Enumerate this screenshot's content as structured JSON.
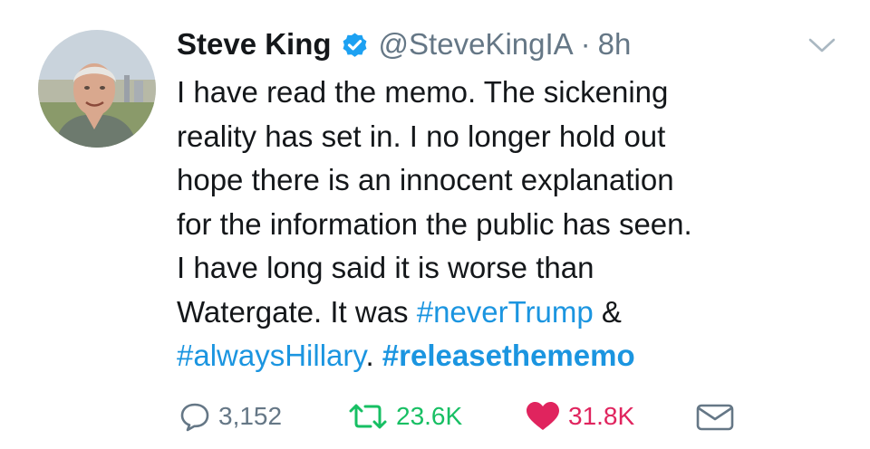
{
  "tweet": {
    "author": {
      "name": "Steve King",
      "handle": "@SteveKingIA",
      "separator": "·",
      "time": "8h",
      "avatar_icon": "profile-photo",
      "verified_icon": "verified-badge-icon"
    },
    "text_lines": [
      [
        {
          "text": "I have read the memo. The sickening",
          "kind": "plain"
        }
      ],
      [
        {
          "text": "reality has set in. I no longer hold out",
          "kind": "plain"
        }
      ],
      [
        {
          "text": "hope there is an innocent explanation",
          "kind": "plain"
        }
      ],
      [
        {
          "text": "for the information the public has seen.",
          "kind": "plain"
        }
      ],
      [
        {
          "text": "I have long said it is worse than",
          "kind": "plain"
        }
      ],
      [
        {
          "text": "Watergate. It was ",
          "kind": "plain"
        },
        {
          "text": "#neverTrump",
          "kind": "hashtag"
        },
        {
          "text": " &",
          "kind": "plain"
        }
      ],
      [
        {
          "text": "#alwaysHillary",
          "kind": "hashtag"
        },
        {
          "text": ". ",
          "kind": "plain"
        },
        {
          "text": "#releasethememo",
          "kind": "hashtag-bold"
        }
      ]
    ],
    "actions": {
      "replies": "3,152",
      "retweets": "23.6K",
      "likes": "31.8K",
      "reply_icon": "reply-icon",
      "retweet_icon": "retweet-icon",
      "like_icon": "heart-icon",
      "dm_icon": "envelope-icon",
      "menu_icon": "chevron-down-icon"
    },
    "colors": {
      "text": "#14171a",
      "muted": "#657786",
      "link": "#1b95e0",
      "retweet": "#17bf63",
      "like": "#e0245e"
    }
  }
}
